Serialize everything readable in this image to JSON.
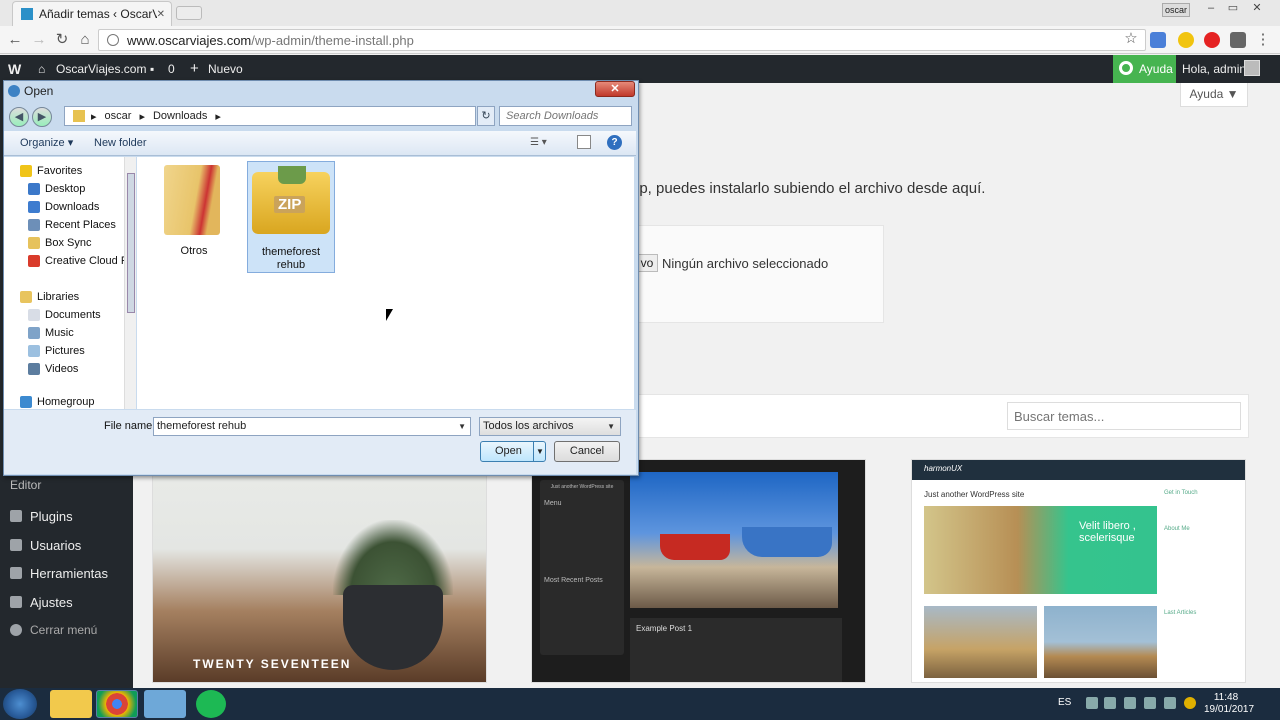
{
  "browser": {
    "tab_title": "Añadir temas ‹ OscarViaj",
    "profile_chip": "oscar",
    "url_domain": "www.oscarviajes.com",
    "url_path": "/wp-admin/theme-install.php",
    "controls": {
      "min": "–",
      "max": "▭",
      "close": "✕",
      "back": "←",
      "forward": "→",
      "reload": "↻",
      "home": "⌂",
      "star": "☆",
      "menu": "⋮"
    }
  },
  "adminbar": {
    "wp_logo": "W",
    "site_icon": "⌂",
    "site_name": "OscarViajes.com",
    "comments_icon": "▪",
    "comments_count": "0",
    "new_icon": "+",
    "new_label": "Nuevo",
    "help_label": "Ayuda",
    "greeting": "Hola, admin"
  },
  "content": {
    "help_tab": "Ayuda ▼",
    "upload_description": "ip, puedes instalarlo subiendo el archivo desde aquí.",
    "file_button_fragment": "vo",
    "no_file_text": "Ningún archivo seleccionado",
    "search_placeholder": "Buscar temas..."
  },
  "sidebar": {
    "items": [
      {
        "label": "Editor"
      },
      {
        "label": "Plugins"
      },
      {
        "label": "Usuarios"
      },
      {
        "label": "Herramientas"
      },
      {
        "label": "Ajustes"
      },
      {
        "label": "Cerrar menú"
      }
    ]
  },
  "themes": [
    {
      "caption": "TWENTY SEVENTEEN"
    },
    {
      "site_title": "Just another WordPress site",
      "menu_title": "Menu",
      "recent_title": "Most Recent Posts",
      "post_title": "Example Post 1"
    },
    {
      "brand": "harmonUX",
      "tagline": "Just another WordPress site",
      "slide_text": "Velit libero , scelerisque",
      "side_title1": "Get in Touch",
      "side_title2": "About Me",
      "side_title3": "Last Articles"
    }
  ],
  "dialog": {
    "title": "Open",
    "close": "✕",
    "nav_back": "◀",
    "nav_forward": "▶",
    "breadcrumb": [
      "oscar",
      "Downloads"
    ],
    "refresh": "↻",
    "search_placeholder": "Search Downloads",
    "organize_label": "Organize ▾",
    "new_folder_label": "New folder",
    "view_label": "☰ ▾",
    "help_label": "?",
    "favorites_header": "Favorites",
    "favorites": [
      "Desktop",
      "Downloads",
      "Recent Places",
      "Box Sync",
      "Creative Cloud Fil"
    ],
    "libraries_header": "Libraries",
    "libraries": [
      "Documents",
      "Music",
      "Pictures",
      "Videos"
    ],
    "homegroup": "Homegroup",
    "files": [
      {
        "name": "Otros",
        "type": "folder"
      },
      {
        "name": "themeforest rehub",
        "type": "zip",
        "selected": true
      }
    ],
    "zip_label": "ZIP",
    "file_name_label": "File name:",
    "file_name_value": "themeforest rehub",
    "file_type_value": "Todos los archivos",
    "open_label": "Open",
    "cancel_label": "Cancel"
  },
  "taskbar": {
    "language": "ES",
    "time": "11:48",
    "date": "19/01/2017"
  }
}
